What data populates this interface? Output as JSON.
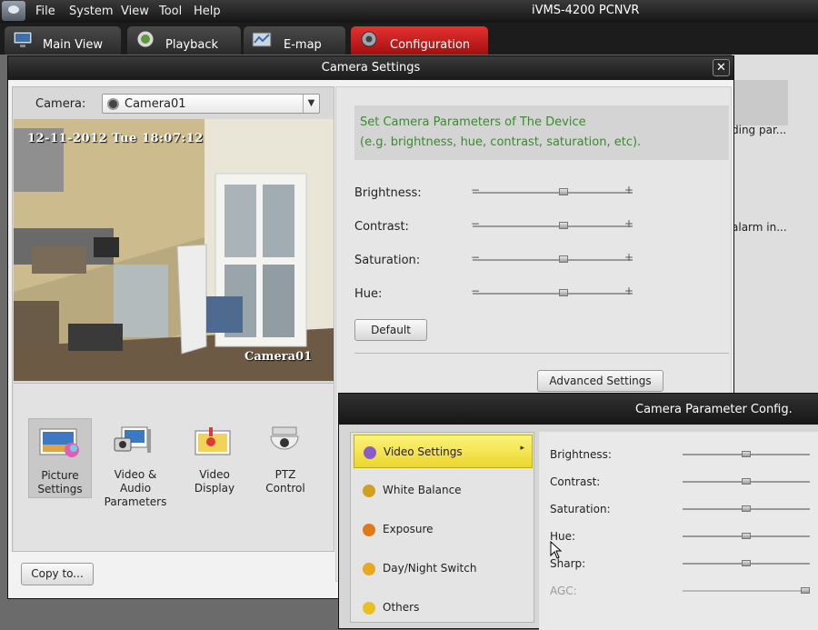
{
  "menubar": {
    "items": [
      "File",
      "System",
      "View",
      "Tool",
      "Help"
    ],
    "app_title": "iVMS-4200 PCNVR"
  },
  "tabs": [
    {
      "label": "Main View",
      "icon": "monitor-icon"
    },
    {
      "label": "Playback",
      "icon": "playback-icon"
    },
    {
      "label": "E-map",
      "icon": "emap-icon"
    },
    {
      "label": "Configuration",
      "icon": "gear-icon",
      "active": true
    }
  ],
  "background_page": {
    "text1": "ding par...",
    "text2": "alarm in..."
  },
  "camera_settings": {
    "title": "Camera Settings",
    "camera_label": "Camera:",
    "camera_value": "Camera01",
    "video": {
      "timestamp": "12-11-2012 Tue 18:07:12",
      "camera_name": "Camera01"
    },
    "icons": [
      {
        "label1": "Picture",
        "label2": "Settings",
        "icon": "picture-settings-icon",
        "selected": true
      },
      {
        "label1": "Video & Audio",
        "label2": "Parameters",
        "icon": "video-audio-icon",
        "selected": false
      },
      {
        "label1": "Video",
        "label2": "Display",
        "icon": "video-display-icon",
        "selected": false
      },
      {
        "label1": "PTZ",
        "label2": "Control",
        "icon": "ptz-camera-icon",
        "selected": false
      }
    ],
    "copy_button": "Copy to...",
    "info_line1": "Set Camera Parameters of The Device",
    "info_line2": "(e.g. brightness, hue, contrast, saturation, etc).",
    "sliders": [
      {
        "label": "Brightness:",
        "value": 0.55
      },
      {
        "label": "Contrast:",
        "value": 0.55
      },
      {
        "label": "Saturation:",
        "value": 0.55
      },
      {
        "label": "Hue:",
        "value": 0.55
      }
    ],
    "default_button": "Default",
    "advanced_button": "Advanced Settings"
  },
  "param_config": {
    "title": "Camera Parameter Config.",
    "menu": [
      {
        "label": "Video Settings",
        "icon": "video-settings-icon",
        "color": "#8a5cc9",
        "selected": true
      },
      {
        "label": "White Balance",
        "icon": "white-balance-icon",
        "color": "#d0a020",
        "selected": false
      },
      {
        "label": "Exposure",
        "icon": "exposure-icon",
        "color": "#e07a18",
        "selected": false
      },
      {
        "label": "Day/Night Switch",
        "icon": "day-night-icon",
        "color": "#e8a820",
        "selected": false
      },
      {
        "label": "Others",
        "icon": "star-icon",
        "color": "#e8c020",
        "selected": false
      }
    ],
    "sliders": [
      {
        "label": "Brightness:",
        "value": 0.5,
        "disabled": false
      },
      {
        "label": "Contrast:",
        "value": 0.5,
        "disabled": false
      },
      {
        "label": "Saturation:",
        "value": 0.5,
        "disabled": false
      },
      {
        "label": "Hue:",
        "value": 0.5,
        "disabled": false
      },
      {
        "label": "Sharp:",
        "value": 0.5,
        "disabled": false
      },
      {
        "label": "AGC:",
        "value": 1.0,
        "disabled": true
      }
    ]
  },
  "colors": {
    "active_tab": "#d42020",
    "info_text": "#3a8a2e",
    "selected_menu": "#f2e04a"
  }
}
